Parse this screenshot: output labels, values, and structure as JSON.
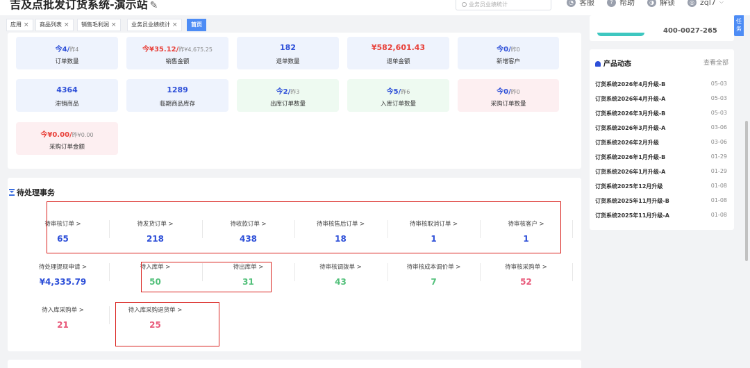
{
  "header": {
    "title": "吉及点批发订货系统-演示站",
    "edit_icon": "✎",
    "search_placeholder": "业务员业绩统计",
    "menu": [
      {
        "label": "客服",
        "icon": "headset-icon"
      },
      {
        "label": "帮助",
        "icon": "help-icon"
      },
      {
        "label": "解锁",
        "icon": "unlock-icon"
      },
      {
        "label": "zql7",
        "icon": "user-icon"
      }
    ]
  },
  "tabs": [
    {
      "label": "应用",
      "close": "×"
    },
    {
      "label": "商品列表",
      "close": "×"
    },
    {
      "label": "销售毛利润",
      "close": "×"
    },
    {
      "label": "业务员业绩统计",
      "close": "×"
    },
    {
      "label": "首页",
      "active": true
    }
  ],
  "stats": [
    {
      "today": "今4/",
      "yest": "昨4",
      "label": "订单数量"
    },
    {
      "today": "今¥35.12/",
      "yest": "昨¥4,675.25",
      "label": "销售金额"
    },
    {
      "value": "182",
      "label": "退单数量"
    },
    {
      "value": "¥582,601.43",
      "label": "退单金额"
    },
    {
      "today": "今0/",
      "yest": "昨0",
      "label": "新增客户"
    },
    {
      "value": "4364",
      "label": "滞销商品"
    },
    {
      "value": "1289",
      "label": "临期商品库存"
    },
    {
      "today": "今2/",
      "yest": "昨3",
      "label": "出库订单数量"
    },
    {
      "today": "今5/",
      "yest": "昨6",
      "label": "入库订单数量"
    },
    {
      "today": "今0/",
      "yest": "昨0",
      "label": "采购订单数量"
    },
    {
      "today": "今¥0.00/",
      "yest": "昨¥0.00",
      "label": "采购订单金额"
    }
  ],
  "pending": {
    "title": "待处理事务",
    "items": [
      {
        "label": "待审核订单 >",
        "value": "65",
        "color": "#2d4fd8"
      },
      {
        "label": "待发货订单 >",
        "value": "218",
        "color": "#2d4fd8"
      },
      {
        "label": "待收款订单 >",
        "value": "438",
        "color": "#2d4fd8"
      },
      {
        "label": "待审核售后订单 >",
        "value": "18",
        "color": "#2d4fd8"
      },
      {
        "label": "待审核取消订单 >",
        "value": "1",
        "color": "#2d4fd8"
      },
      {
        "label": "待审核客户 >",
        "value": "1",
        "color": "#2d4fd8"
      },
      {
        "label": "待处理提现申请 >",
        "value": "¥4,335.79",
        "color": "#2d4fd8"
      },
      {
        "label": "待入库单 >",
        "value": "50",
        "color": "#52c07a"
      },
      {
        "label": "待出库单 >",
        "value": "31",
        "color": "#52c07a"
      },
      {
        "label": "待审核调拨单 >",
        "value": "43",
        "color": "#52c07a"
      },
      {
        "label": "待审核成本调价单 >",
        "value": "7",
        "color": "#52c07a"
      },
      {
        "label": "待审核采购单 >",
        "value": "52",
        "color": "#e8597a"
      },
      {
        "label": "待入库采购单 >",
        "value": "21",
        "color": "#e8597a"
      },
      {
        "label": "待入库采购退货单 >",
        "value": "25",
        "color": "#e8597a"
      }
    ]
  },
  "sidebar": {
    "phone": "400-0027-265",
    "news_title": "产品动态",
    "view_all": "查看全部",
    "news": [
      {
        "title": "订货系统2026年4月升级-B",
        "date": "05-03"
      },
      {
        "title": "订货系统2026年4月升级-A",
        "date": "05-03"
      },
      {
        "title": "订货系统2026年3月升级-B",
        "date": "05-03"
      },
      {
        "title": "订货系统2026年3月升级-A",
        "date": "03-06"
      },
      {
        "title": "订货系统2026年2月升级",
        "date": "03-06"
      },
      {
        "title": "订货系统2026年1月升级-B",
        "date": "01-29"
      },
      {
        "title": "订货系统2026年1月升级-A",
        "date": "01-29"
      },
      {
        "title": "订货系统2025年12月升级",
        "date": "01-08"
      },
      {
        "title": "订货系统2025年11月升级-B",
        "date": "01-08"
      },
      {
        "title": "订货系统2025年11月升级-A",
        "date": "01-08"
      }
    ],
    "side_tab": "任务"
  }
}
